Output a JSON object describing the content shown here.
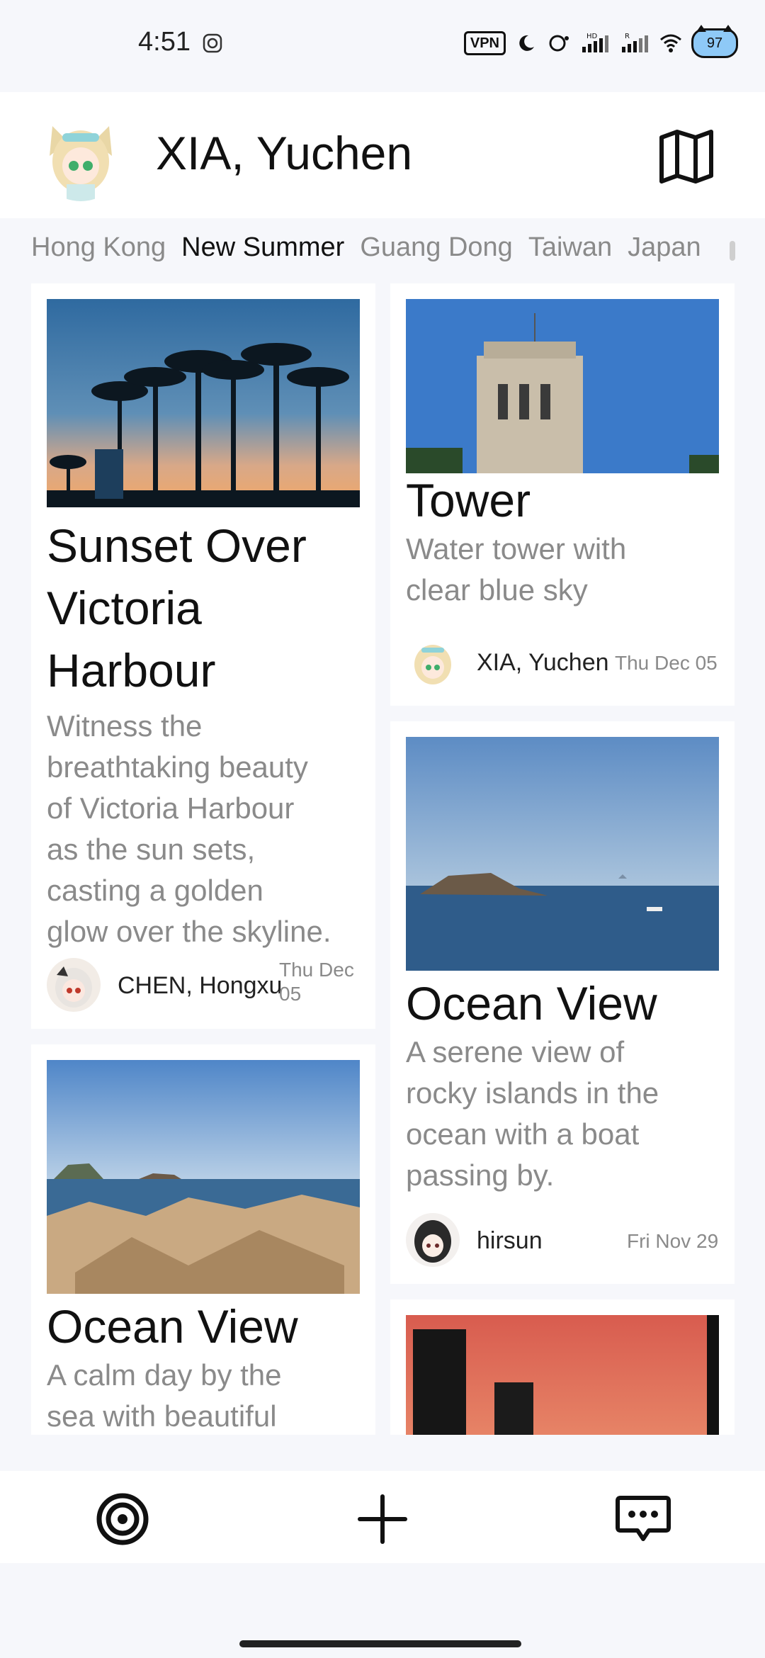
{
  "status_bar": {
    "time": "4:51",
    "vpn_label": "VPN",
    "battery": "97",
    "icons": [
      "screen-record-icon",
      "moon-icon",
      "alarm-icon",
      "signal-hd-icon",
      "signal-r-icon",
      "wifi-icon"
    ]
  },
  "header": {
    "user_name": "XIA, Yuchen",
    "map_icon": "map-icon"
  },
  "tabs": [
    {
      "label": "Hong Kong",
      "active": false
    },
    {
      "label": "New Summer",
      "active": true
    },
    {
      "label": "Guang Dong",
      "active": false
    },
    {
      "label": "Taiwan",
      "active": false
    },
    {
      "label": "Japan",
      "active": false
    }
  ],
  "posts": [
    {
      "title_lines": [
        "Sunset Over",
        "Victoria",
        "Harbour"
      ],
      "description_lines": [
        "Witness the",
        "breathtaking beauty",
        "of Victoria Harbour",
        "as the sun sets,",
        "casting a golden",
        "glow over the skyline."
      ],
      "author": "CHEN, Hongxu",
      "date_lines": [
        "Thu Dec",
        "05"
      ]
    },
    {
      "title_lines": [
        "Tower"
      ],
      "description_lines": [
        "Water tower with",
        "clear blue sky"
      ],
      "author": "XIA, Yuchen",
      "date": "Thu Dec 05"
    },
    {
      "title_lines": [
        "Ocean View"
      ],
      "description_lines": [
        "A serene view of",
        "rocky islands in the",
        "ocean with a boat",
        "passing by."
      ],
      "author": "hirsun",
      "date": "Fri Nov 29"
    },
    {
      "title_lines": [
        "Ocean View"
      ],
      "description_lines": [
        "A calm day by the",
        "sea with beautiful"
      ]
    },
    {
      "title_lines": []
    }
  ],
  "bottom_nav": {
    "icons": [
      "target-icon",
      "plus-icon",
      "chat-icon"
    ]
  }
}
